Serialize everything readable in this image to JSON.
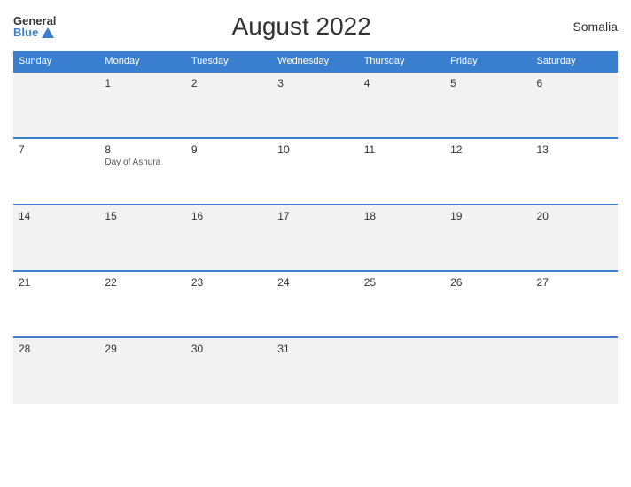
{
  "header": {
    "logo_general": "General",
    "logo_blue": "Blue",
    "title": "August 2022",
    "country": "Somalia"
  },
  "days_of_week": [
    "Sunday",
    "Monday",
    "Tuesday",
    "Wednesday",
    "Thursday",
    "Friday",
    "Saturday"
  ],
  "weeks": [
    {
      "days": [
        {
          "date": "",
          "event": ""
        },
        {
          "date": "1",
          "event": ""
        },
        {
          "date": "2",
          "event": ""
        },
        {
          "date": "3",
          "event": ""
        },
        {
          "date": "4",
          "event": ""
        },
        {
          "date": "5",
          "event": ""
        },
        {
          "date": "6",
          "event": ""
        }
      ]
    },
    {
      "days": [
        {
          "date": "7",
          "event": ""
        },
        {
          "date": "8",
          "event": "Day of Ashura"
        },
        {
          "date": "9",
          "event": ""
        },
        {
          "date": "10",
          "event": ""
        },
        {
          "date": "11",
          "event": ""
        },
        {
          "date": "12",
          "event": ""
        },
        {
          "date": "13",
          "event": ""
        }
      ]
    },
    {
      "days": [
        {
          "date": "14",
          "event": ""
        },
        {
          "date": "15",
          "event": ""
        },
        {
          "date": "16",
          "event": ""
        },
        {
          "date": "17",
          "event": ""
        },
        {
          "date": "18",
          "event": ""
        },
        {
          "date": "19",
          "event": ""
        },
        {
          "date": "20",
          "event": ""
        }
      ]
    },
    {
      "days": [
        {
          "date": "21",
          "event": ""
        },
        {
          "date": "22",
          "event": ""
        },
        {
          "date": "23",
          "event": ""
        },
        {
          "date": "24",
          "event": ""
        },
        {
          "date": "25",
          "event": ""
        },
        {
          "date": "26",
          "event": ""
        },
        {
          "date": "27",
          "event": ""
        }
      ]
    },
    {
      "days": [
        {
          "date": "28",
          "event": ""
        },
        {
          "date": "29",
          "event": ""
        },
        {
          "date": "30",
          "event": ""
        },
        {
          "date": "31",
          "event": ""
        },
        {
          "date": "",
          "event": ""
        },
        {
          "date": "",
          "event": ""
        },
        {
          "date": "",
          "event": ""
        }
      ]
    }
  ]
}
